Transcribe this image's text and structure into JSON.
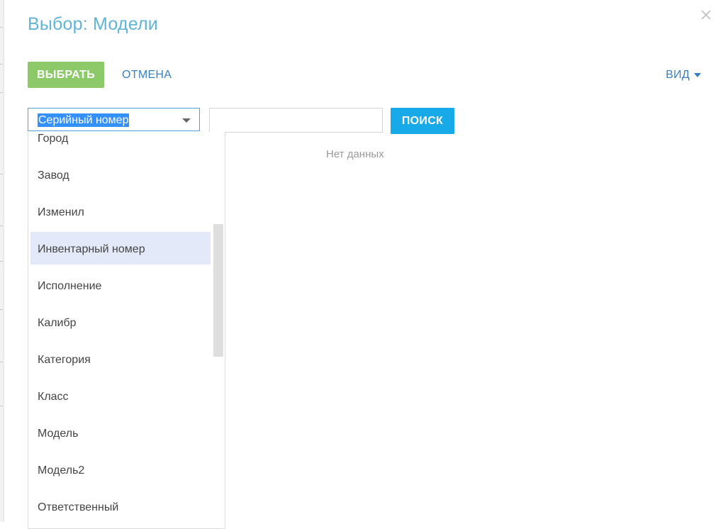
{
  "dialog": {
    "title": "Выбор: Модели",
    "close_icon": "close-icon"
  },
  "toolbar": {
    "select_label": "ВЫБРАТЬ",
    "cancel_label": "ОТМЕНА",
    "view_label": "ВИД",
    "colors": {
      "select_bg": "#8cc968",
      "link": "#3a7fc2",
      "title": "#5fb4d8"
    }
  },
  "filter": {
    "column_selected": "Серийный номер",
    "search_value": "",
    "search_button": "ПОИСК",
    "search_button_color": "#17a9e8"
  },
  "results": {
    "empty_text": "Нет данных"
  },
  "dropdown": {
    "items": [
      {
        "label": "Город"
      },
      {
        "label": "Завод"
      },
      {
        "label": "Изменил"
      },
      {
        "label": "Инвентарный номер",
        "highlighted": true
      },
      {
        "label": "Исполнение"
      },
      {
        "label": "Калибр"
      },
      {
        "label": "Категория"
      },
      {
        "label": "Класс"
      },
      {
        "label": "Модель"
      },
      {
        "label": "Модель2"
      },
      {
        "label": "Ответственный"
      }
    ],
    "highlight_color": "#e3e9f8"
  }
}
